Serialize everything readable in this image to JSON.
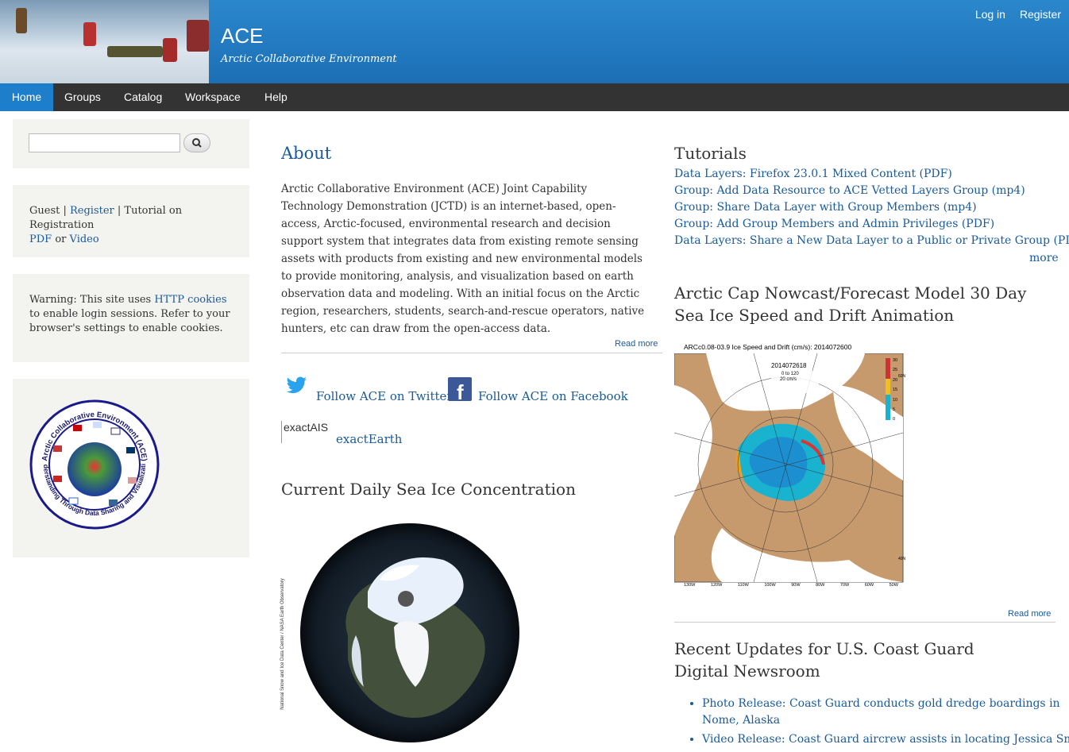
{
  "header": {
    "site_name": "ACE",
    "slogan": "Arctic Collaborative Environment",
    "login": "Log in",
    "register": "Register"
  },
  "nav": {
    "items": [
      "Home",
      "Groups",
      "Catalog",
      "Workspace",
      "Help"
    ],
    "active": "Home"
  },
  "sidebar": {
    "search": {
      "value": "",
      "button_icon": "search-icon"
    },
    "guest": {
      "prefix": "Guest |",
      "register": "Register",
      "middle": "| Tutorial on Registration",
      "pdf": "PDF",
      "or": "or",
      "video": "Video"
    },
    "warning": {
      "prefix": "Warning: This site uses",
      "link": "HTTP cookies",
      "suffix": "to enable login sessions. Refer to your browser's settings to enable cookies."
    },
    "logo": {
      "top_text": "Arctic Collaborative Environment (ACE)",
      "bottom_text": "Understanding Through Data Sharing and Visualization"
    }
  },
  "about": {
    "title": "About",
    "body": "Arctic Collaborative Environment (ACE) Joint Capability Technology Demonstration (JCTD) is an internet-based, open-access, Arctic-focused, environmental research and decision support system that integrates data from existing remote sensing assets with products from existing and new environmental models to provide monitoring, analysis, and visualization based on earth observation data and modeling. With an initial focus on the Arctic region, researchers, students, search-and-rescue operators, native hunters, etc can draw from the open-access data.",
    "read_more": "Read more"
  },
  "social": {
    "twitter": "Follow ACE on Twitter",
    "facebook": "Follow ACE on Facebook",
    "exactais_logo": "exactAIS",
    "exactearth": "exactEarth"
  },
  "sea_ice": {
    "title": "Current Daily Sea Ice Concentration",
    "credit": "National Snow and Ice Data Center / NASA Earth Observatory"
  },
  "tutorials": {
    "title": "Tutorials",
    "items": [
      "Data Layers: Firefox 23.0.1 Mixed Content (PDF)",
      "Group: Add Data Resource to ACE Vetted Layers Group (mp4)",
      "Group: Share Data Layer with Group Members (mp4)",
      "Group: Add Group Members and Admin Privileges (PDF)",
      "Data Layers: Share a New Data Layer to a Public or Private Group (PDF)"
    ],
    "more": "more"
  },
  "arctic_cap": {
    "title": "Arctic Cap Nowcast/Forecast Model 30 Day Sea Ice Speed and Drift Animation",
    "map_title": "ARCc0.08-03.9 Ice Speed and Drift (cm/s): 2014072600",
    "date": "2014072618",
    "scale": "0 to 120",
    "vec": "20 cm/s",
    "colorbar": [
      "30",
      "25",
      "20",
      "15",
      "10",
      "5",
      "0"
    ],
    "lon_labels": [
      "130W",
      "120W",
      "110W",
      "100W",
      "90W",
      "80W",
      "70W",
      "60W",
      "50W"
    ],
    "lat_labels": [
      "60N",
      "40N"
    ],
    "read_more": "Read more"
  },
  "uscg": {
    "title": "Recent Updates for U.S. Coast Guard Digital Newsroom",
    "items": [
      "Photo Release: Coast Guard conducts gold dredge boardings in Nome, Alaska",
      "Video Release: Coast Guard aircrew assists in locating Jessica Smith in"
    ]
  }
}
